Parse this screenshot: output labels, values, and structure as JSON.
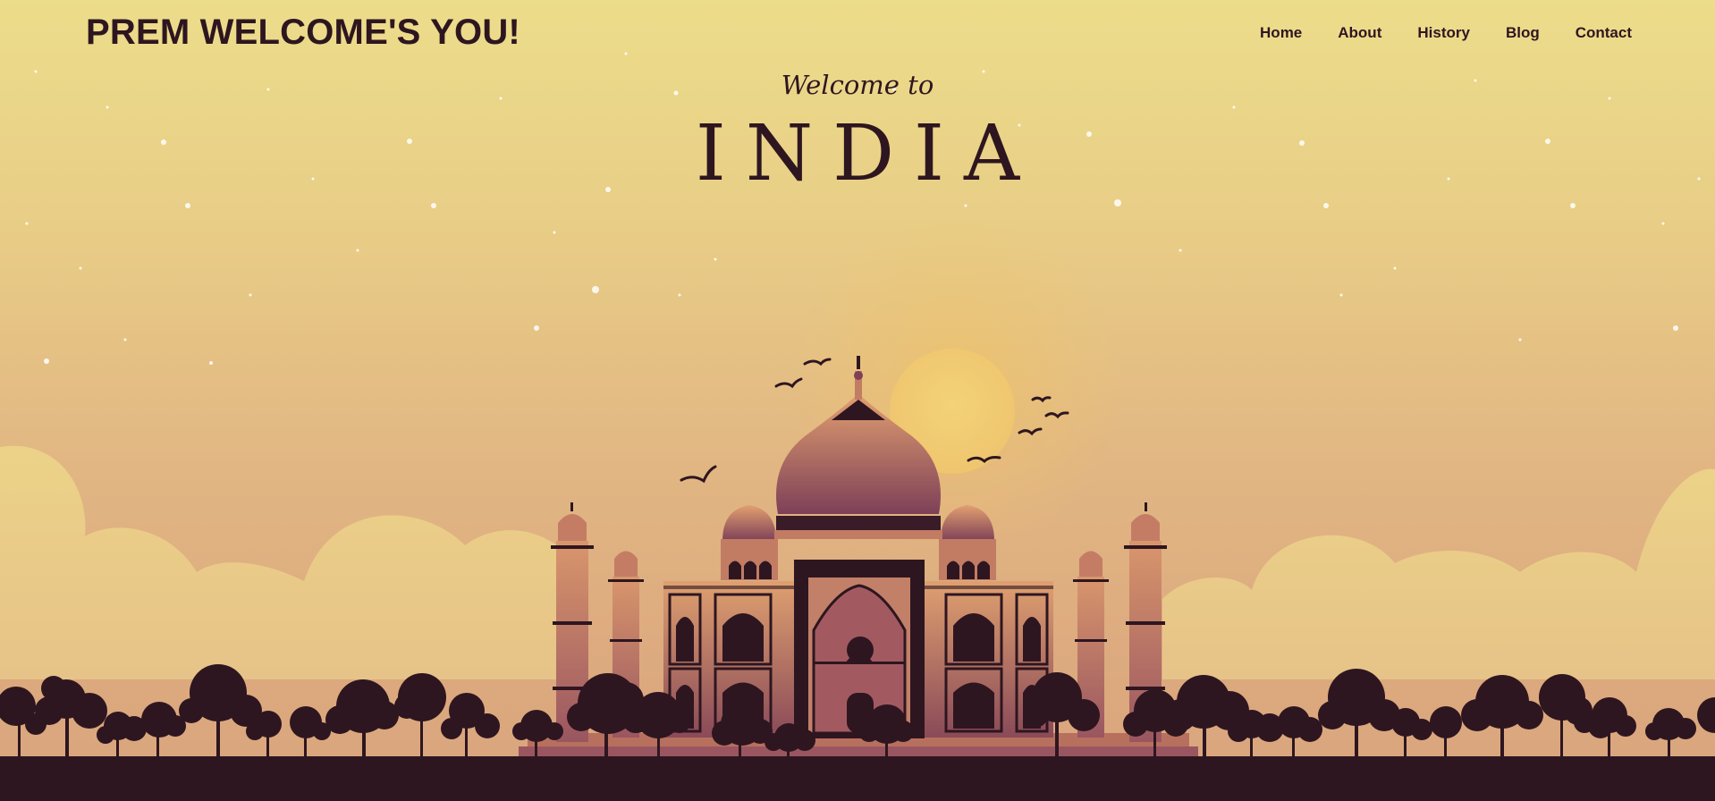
{
  "header": {
    "brand": "PREM WELCOME'S YOU!",
    "nav": [
      "Home",
      "About",
      "History",
      "Blog",
      "Contact"
    ]
  },
  "hero": {
    "welcome": "Welcome to",
    "title": "INDIA"
  },
  "illustration": {
    "subject": "taj-mahal",
    "colors": {
      "sky_top": "#ecdd8a",
      "sky_bottom": "#d9a47d",
      "silhouette": "#2e1620",
      "sun": "#efc66f",
      "clouds": "#ecd288",
      "marble": "#d6906a"
    }
  }
}
